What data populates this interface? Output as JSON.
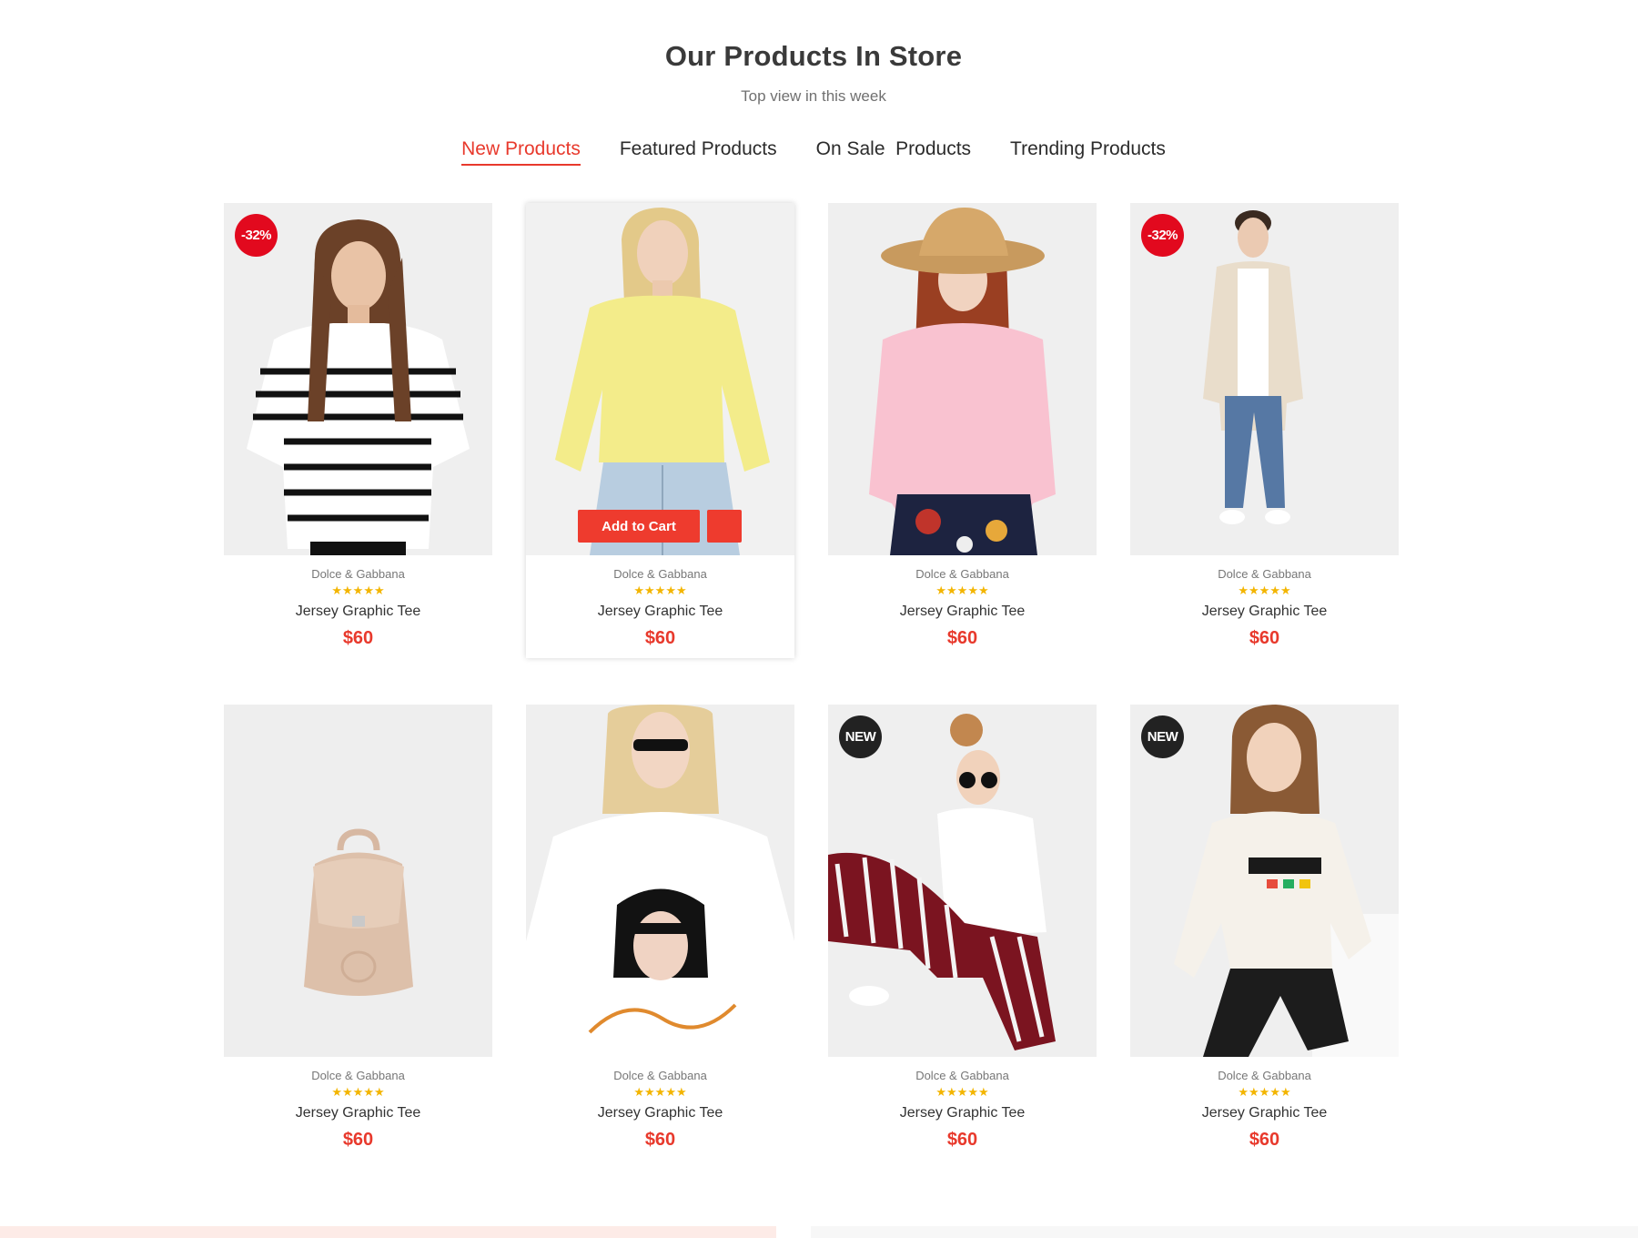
{
  "section": {
    "title": "Our Products In Store",
    "subtitle": "Top view in this week"
  },
  "tabs": [
    {
      "label": "New Products",
      "active": true
    },
    {
      "label": "Featured Products",
      "active": false
    },
    {
      "label": "On Sale  Products",
      "active": false
    },
    {
      "label": "Trending Products",
      "active": false
    }
  ],
  "hover_actions": {
    "add_to_cart_label": "Add to Cart",
    "quick_view_icon": "eye-icon"
  },
  "colors": {
    "accent": "#e8392c",
    "sale_badge": "#e2091e",
    "new_badge": "#222222",
    "star": "#f3b500"
  },
  "products": [
    {
      "brand": "Dolce & Gabbana",
      "rating": 5,
      "stars": "★★★★★",
      "name": "Jersey Graphic Tee",
      "price": "$60",
      "badge": "-32%",
      "image": "woman in white black striped tee"
    },
    {
      "brand": "Dolce & Gabbana",
      "rating": 5,
      "stars": "★★★★★",
      "name": "Jersey Graphic Tee",
      "price": "$60",
      "badge": "",
      "image": "woman in yellow sweater and jeans"
    },
    {
      "brand": "Dolce & Gabbana",
      "rating": 5,
      "stars": "★★★★★",
      "name": "Jersey Graphic Tee",
      "price": "$60",
      "badge": "",
      "image": "woman in straw hat and pink sweater"
    },
    {
      "brand": "Dolce & Gabbana",
      "rating": 5,
      "stars": "★★★★★",
      "name": "Jersey Graphic Tee",
      "price": "$60",
      "badge": "-32%",
      "image": "man in beige cardigan and jeans"
    },
    {
      "brand": "Dolce & Gabbana",
      "rating": 5,
      "stars": "★★★★★",
      "name": "Jersey Graphic Tee",
      "price": "$60",
      "badge": "",
      "image": "beige leather backpack"
    },
    {
      "brand": "Dolce & Gabbana",
      "rating": 5,
      "stars": "★★★★★",
      "name": "Jersey Graphic Tee",
      "price": "$60",
      "badge": "",
      "image": "woman in white printed tee"
    },
    {
      "brand": "Dolce & Gabbana",
      "rating": 5,
      "stars": "★★★★★",
      "name": "Jersey Graphic Tee",
      "price": "$60",
      "badge": "NEW",
      "image": "woman in slogan tee and striped pants"
    },
    {
      "brand": "Dolce & Gabbana",
      "rating": 5,
      "stars": "★★★★★",
      "name": "Jersey Graphic Tee",
      "price": "$60",
      "badge": "NEW",
      "image": "woman in white sweatshirt and leather pants"
    }
  ]
}
